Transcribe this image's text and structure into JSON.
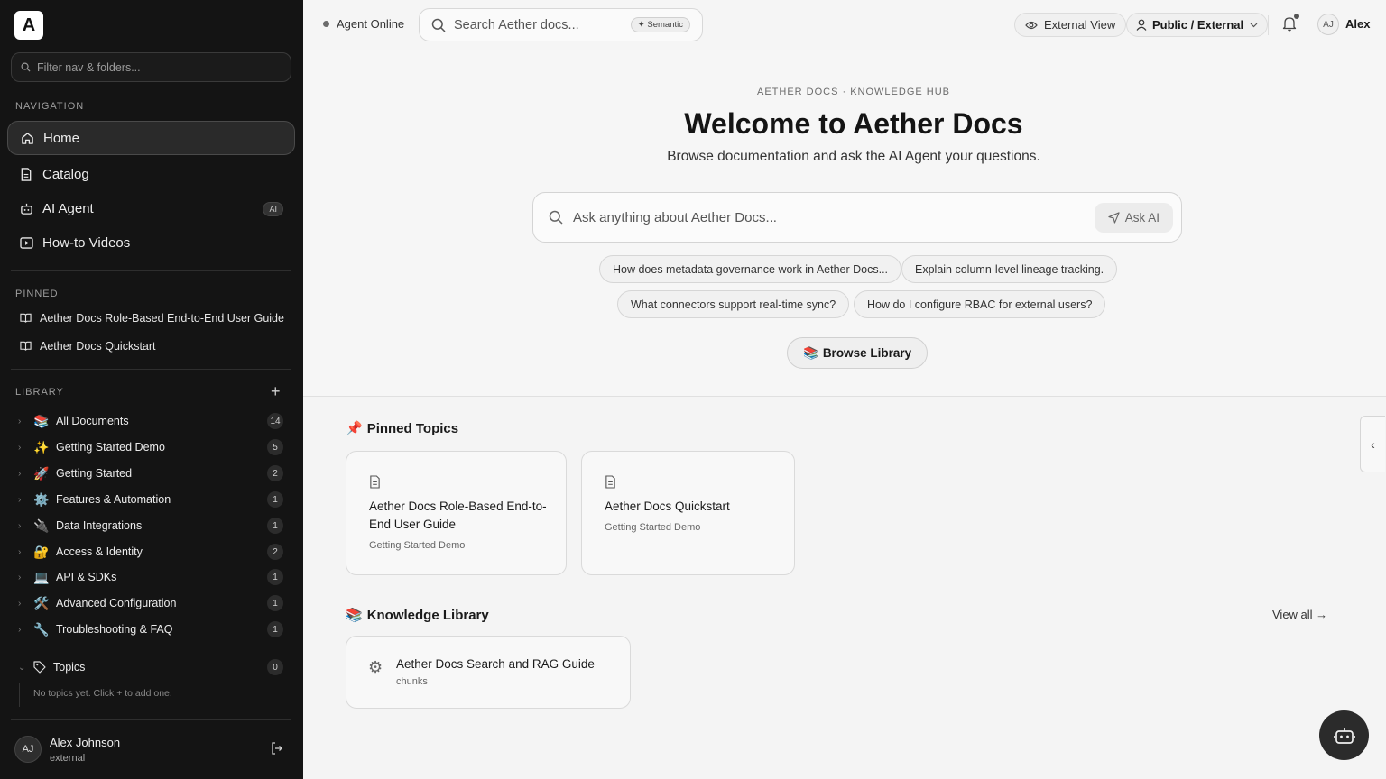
{
  "sidebar": {
    "logo": "A",
    "filter_placeholder": "Filter nav & folders...",
    "navigation_label": "NAVIGATION",
    "nav": [
      {
        "label": "Home",
        "icon": "home-icon",
        "active": true
      },
      {
        "label": "Catalog",
        "icon": "document-icon"
      },
      {
        "label": "AI Agent",
        "icon": "bot-icon",
        "badge": "AI"
      },
      {
        "label": "How-to Videos",
        "icon": "video-icon"
      }
    ],
    "pinned_label": "PINNED",
    "pinned": [
      {
        "label": "Aether Docs Role-Based End-to-End User Guide"
      },
      {
        "label": "Aether Docs Quickstart"
      }
    ],
    "library_label": "LIBRARY",
    "library": [
      {
        "emoji": "📚",
        "label": "All Documents",
        "count": "14"
      },
      {
        "emoji": "✨",
        "label": "Getting Started Demo",
        "count": "5"
      },
      {
        "emoji": "🚀",
        "label": "Getting Started",
        "count": "2"
      },
      {
        "emoji": "⚙️",
        "label": "Features & Automation",
        "count": "1"
      },
      {
        "emoji": "🔌",
        "label": "Data Integrations",
        "count": "1"
      },
      {
        "emoji": "🔐",
        "label": "Access & Identity",
        "count": "2"
      },
      {
        "emoji": "💻",
        "label": "API & SDKs",
        "count": "1"
      },
      {
        "emoji": "🛠️",
        "label": "Advanced Configuration",
        "count": "1"
      },
      {
        "emoji": "🔧",
        "label": "Troubleshooting & FAQ",
        "count": "1"
      }
    ],
    "topics": {
      "label": "Topics",
      "count": "0",
      "empty_text": "No topics yet. Click + to add one."
    },
    "user": {
      "initials": "AJ",
      "name": "Alex Johnson",
      "role": "external"
    }
  },
  "header": {
    "status": "Agent Online",
    "search_placeholder": "Search Aether docs...",
    "semantic_pill": "✦ Semantic",
    "external_view": "External View",
    "visibility": "Public / External",
    "user_initials": "AJ",
    "user_name": "Alex"
  },
  "hero": {
    "eyebrow": "AETHER DOCS · KNOWLEDGE HUB",
    "title": "Welcome to Aether Docs",
    "subtitle": "Browse documentation and ask the AI Agent your questions.",
    "ask_placeholder": "Ask anything about Aether Docs...",
    "ask_button": "Ask AI",
    "suggestions": [
      "How does metadata governance work in Aether Docs...",
      "Explain column-level lineage tracking.",
      "What connectors support real-time sync?",
      "How do I configure RBAC for external users?"
    ],
    "browse_button": "Browse Library"
  },
  "pinned_topics": {
    "heading": "Pinned Topics",
    "cards": [
      {
        "title": "Aether Docs Role-Based End-to-End User Guide",
        "subtitle": "Getting Started Demo"
      },
      {
        "title": "Aether Docs Quickstart",
        "subtitle": "Getting Started Demo"
      }
    ]
  },
  "knowledge_library": {
    "heading": "Knowledge Library",
    "view_all": "View all →",
    "cards": [
      {
        "title": "Aether Docs Search and RAG Guide",
        "subtitle": "chunks"
      }
    ]
  }
}
